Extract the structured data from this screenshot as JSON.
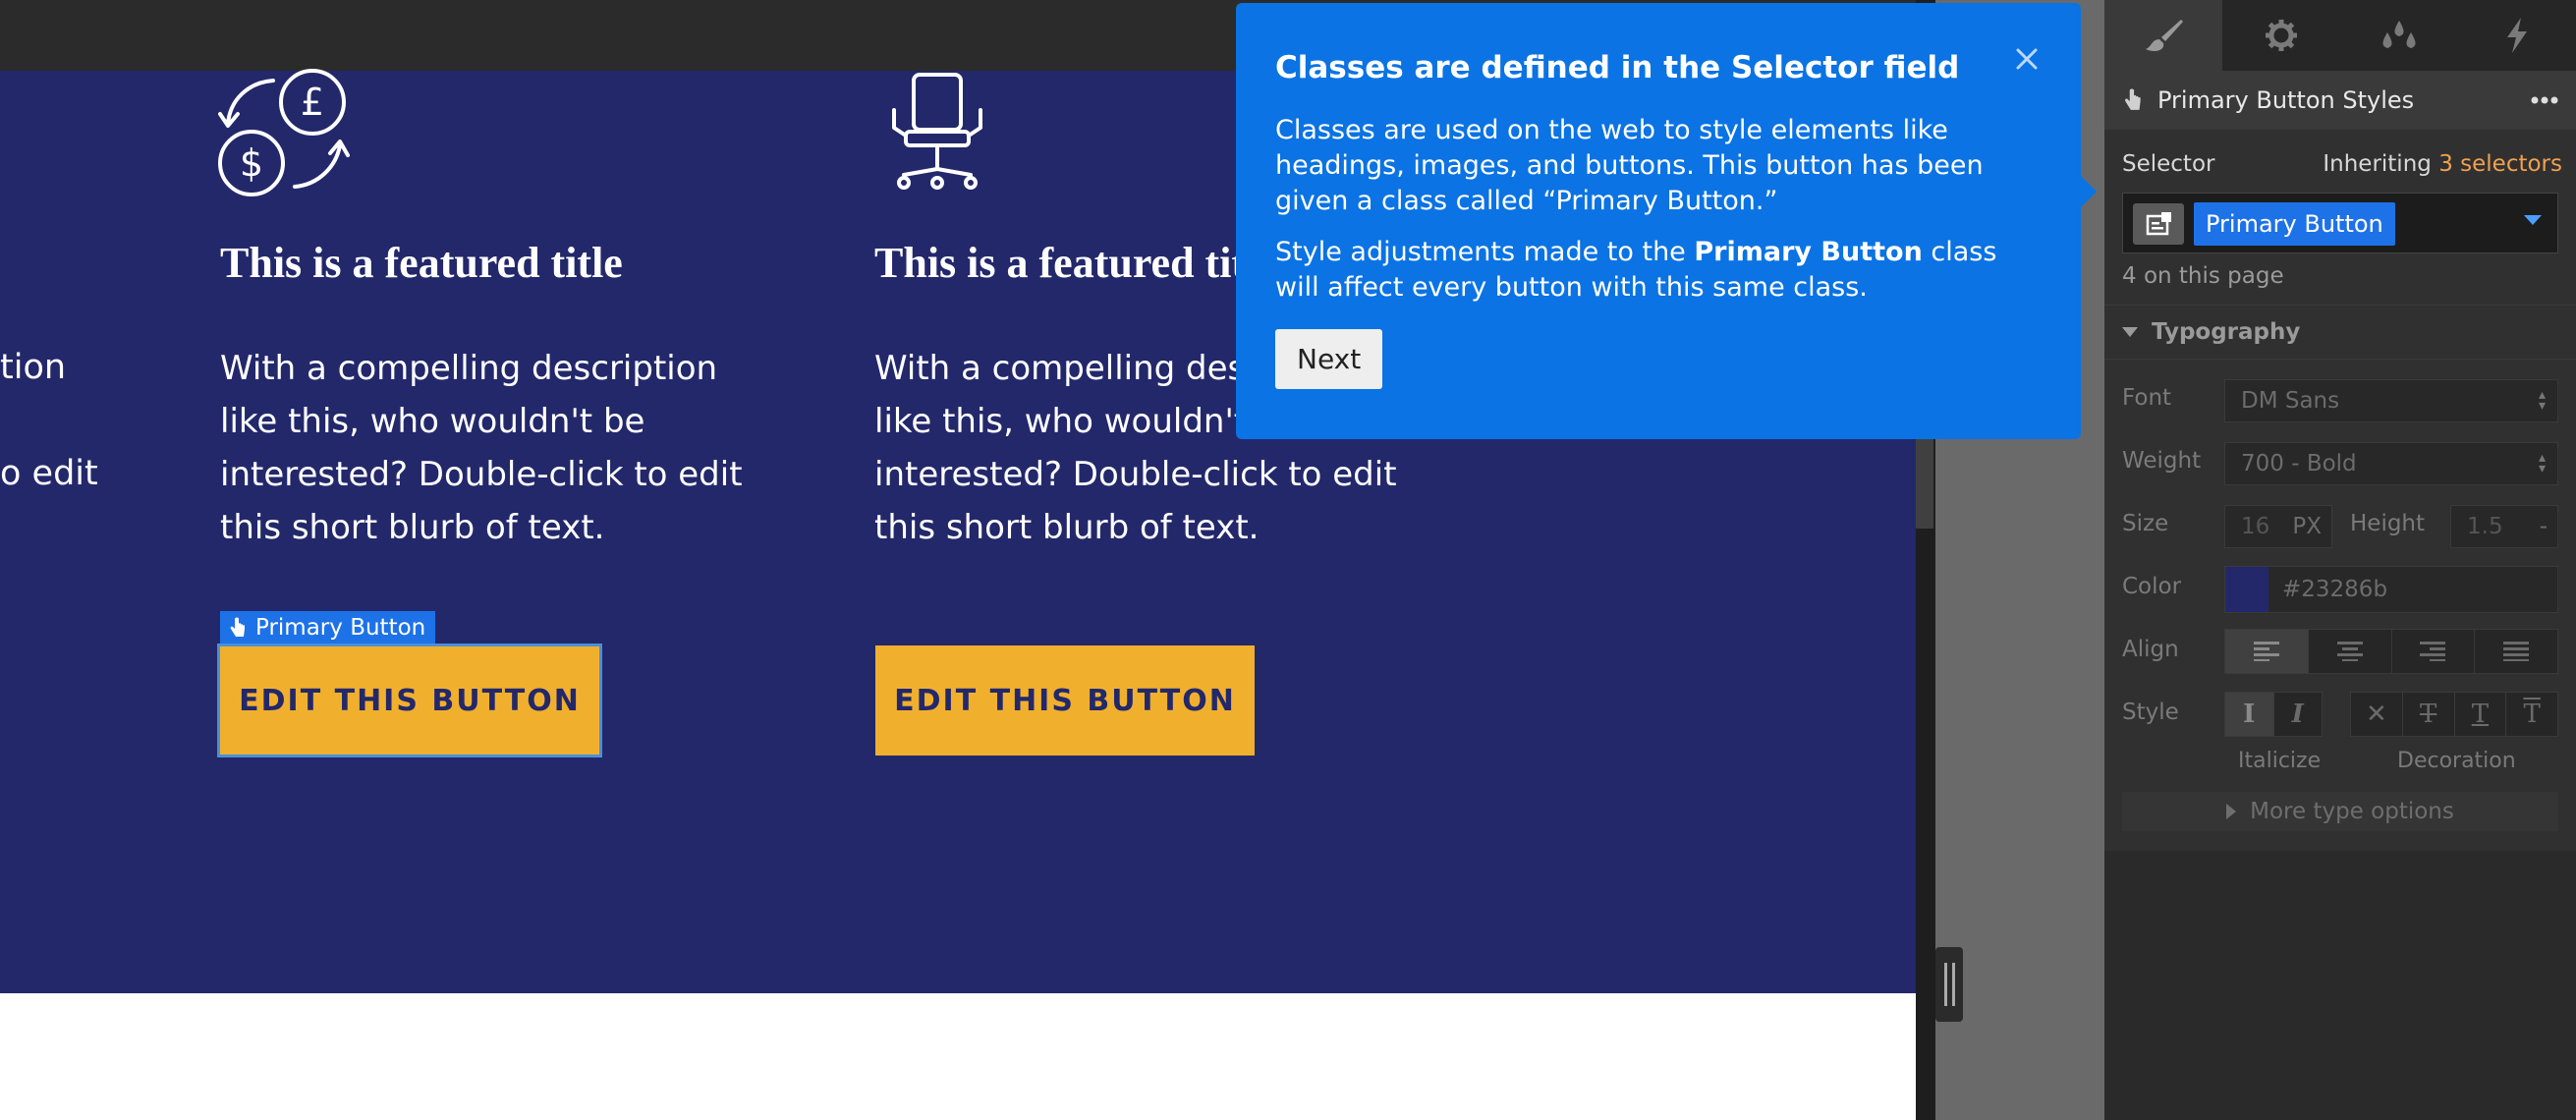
{
  "canvas": {
    "cut_off_text": [
      "tion",
      "o edit"
    ],
    "features": [
      {
        "icon": "currency-exchange-icon",
        "title": "This is a featured title",
        "description": "With a compelling description like this, who wouldn't be interested? Double-click to edit this short blurb of text.",
        "button_label": "EDIT THIS BUTTON"
      },
      {
        "icon": "office-chair-icon",
        "title": "This is a featured title",
        "description": "With a compelling description like this, who wouldn't be interested? Double-click to edit this short blurb of text.",
        "button_label": "EDIT THIS BUTTON"
      }
    ],
    "selection_badge": "Primary Button",
    "colors": {
      "hero_bg": "#23286b",
      "button_bg": "#f0b02e",
      "accent": "#1e72e8"
    }
  },
  "tooltip": {
    "title": "Classes are defined in the Selector field",
    "p1": "Classes are used on the web to style elements like headings, images, and buttons. This button has been given a class called “Primary Button.”",
    "p2_before": "Style adjustments made to the ",
    "p2_bold": "Primary Button",
    "p2_after": " class will affect every button with this same class.",
    "next_label": "Next",
    "close_icon": "close-icon"
  },
  "panel": {
    "tabs": [
      "paintbrush-icon",
      "gear-icon",
      "droplets-icon",
      "lightning-icon"
    ],
    "header_title": "Primary Button Styles",
    "selector_label": "Selector",
    "inheriting_text": "Inheriting",
    "inheriting_count": "3 selectors",
    "selector_pill": "Primary Button",
    "on_page_text": "4 on this page",
    "typography_label": "Typography",
    "font_label": "Font",
    "font_value": "DM Sans",
    "weight_label": "Weight",
    "weight_value": "700 - Bold",
    "size_label": "Size",
    "size_value": "16",
    "size_unit": "PX",
    "height_label": "Height",
    "height_value": "1.5",
    "height_unit": "-",
    "color_label": "Color",
    "color_value": "#23286b",
    "align_label": "Align",
    "style_label": "Style",
    "italicize_label": "Italicize",
    "decoration_label": "Decoration",
    "more_type_options": "More type options"
  }
}
